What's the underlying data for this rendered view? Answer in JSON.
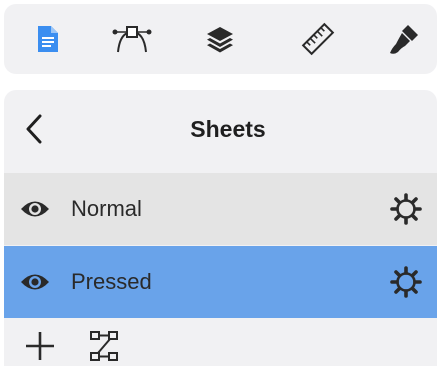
{
  "toolbar": {
    "tools": [
      {
        "name": "document-icon",
        "active": true
      },
      {
        "name": "bezier-pen-icon",
        "active": false
      },
      {
        "name": "layers-icon",
        "active": false
      },
      {
        "name": "ruler-icon",
        "active": false
      },
      {
        "name": "brush-icon",
        "active": false
      }
    ],
    "colors": {
      "active": "#3b8ef0",
      "inactive": "#2a2a2a"
    }
  },
  "panel": {
    "back_icon": "chevron-left-icon",
    "title": "Sheets",
    "sheets": [
      {
        "label": "Normal",
        "selected": false
      },
      {
        "label": "Pressed",
        "selected": true
      }
    ],
    "colors": {
      "selected_row": "#69a3ea",
      "row": "#e4e4e4",
      "panel": "#f1f1f3"
    }
  },
  "bottom_bar": {
    "icons": [
      "plus-icon",
      "connect-nodes-icon"
    ]
  }
}
